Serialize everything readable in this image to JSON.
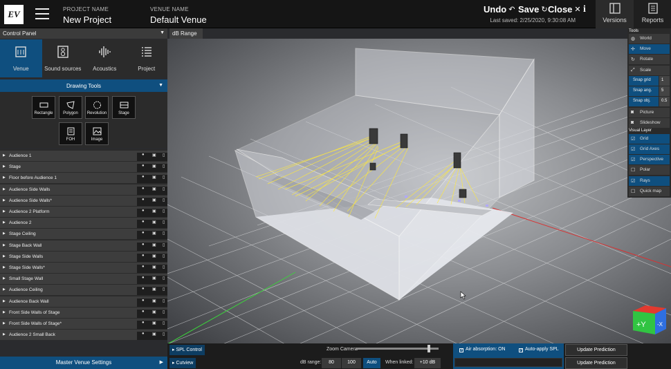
{
  "header": {
    "logo": "EV",
    "project_label": "PROJECT NAME",
    "project_name": "New Project",
    "venue_label": "VENUE NAME",
    "venue_name": "Default Venue",
    "undo": "Undo",
    "save": "Save",
    "close": "Close",
    "last_saved": "Last saved: 2/25/2020, 9:30:08 AM",
    "info": "i",
    "versions": "Versions",
    "reports": "Reports"
  },
  "control_panel": {
    "title": "Control Panel",
    "db_range": "dB Range",
    "tabs": [
      {
        "label": "Venue",
        "icon": "venue-icon"
      },
      {
        "label": "Sound sources",
        "icon": "speaker-icon"
      },
      {
        "label": "Acoustics",
        "icon": "waveform-icon"
      },
      {
        "label": "Project",
        "icon": "list-icon"
      }
    ],
    "drawing_tools_title": "Drawing Tools",
    "tools": [
      "Rectangle",
      "Polygon",
      "Revolution",
      "Stage",
      "FOH",
      "Image"
    ],
    "layers": [
      "Audience 1",
      "Stage",
      "Floor before Audience 1",
      "Audience Side Walls",
      "Audience Side Walls*",
      "Audience 2 Platform",
      "Audience 2",
      "Stage Ceiling",
      "Stage Back Wall",
      "Stage Side Walls",
      "Stage Side Walls*",
      "Small Stage Wall",
      "Audience Ceiling",
      "Audience Back Wall",
      "Front Side Walls of Stage",
      "Front Side Walls of Stage*",
      "Audience 2 Small Back"
    ],
    "master": "Master Venue Settings"
  },
  "right_panel": {
    "tools_title": "Tools",
    "world": "World",
    "move": "Move",
    "rotate": "Rotate",
    "scale": "Scale",
    "snap_grid": "Snap grid",
    "snap_grid_val": "1",
    "snap_ang": "Snap ang.",
    "snap_ang_val": "5",
    "snap_obj": "Snap obj.",
    "snap_obj_val": "0.5",
    "picture": "Picture",
    "slideshow": "Slideshow",
    "visual_title": "Visual Layer",
    "grid": "Grid",
    "grid_axes": "Grid Axes",
    "perspective": "Perspective",
    "polar": "Polar",
    "rays": "Rays",
    "quick_map": "Quick map"
  },
  "bottom": {
    "spl_control": "SPL Control",
    "cutview": "Cutview",
    "zoom_camera": "Zoom Camera",
    "zoom_level": 0.9,
    "db_range_label": "dB range:",
    "db_min": "80",
    "db_max": "100",
    "auto": "Auto",
    "when_linked": "When linked:",
    "linked_value": "+10 dB",
    "air_absorption": "Air absorption: ON",
    "auto_apply": "Auto-apply SPL",
    "update1": "Update Prediction",
    "update2": "Update Prediction"
  },
  "cube": {
    "labels": [
      "+Y",
      "-X"
    ]
  }
}
